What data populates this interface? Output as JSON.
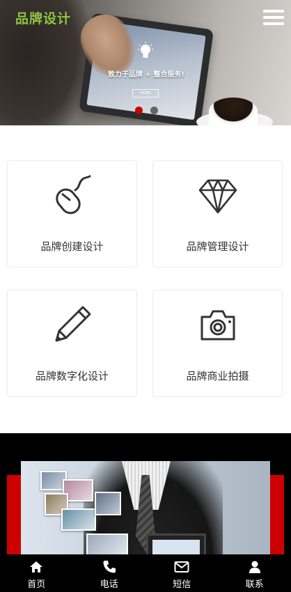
{
  "header": {
    "logo_text": "品牌设计",
    "logo_color": "#8fc642",
    "menu_icon": "hamburger-menu-icon"
  },
  "hero": {
    "slogan": "致力于品牌 + 整合服务!",
    "button_text": "MORE",
    "bulb_icon": "lightbulb-icon",
    "slide_count": 2,
    "active_slide": 1,
    "active_dot_color": "#c90000"
  },
  "services": [
    {
      "label": "品牌创建设计",
      "icon": "mouse-icon"
    },
    {
      "label": "品牌管理设计",
      "icon": "diamond-icon"
    },
    {
      "label": "品牌数字化设计",
      "icon": "pencil-icon"
    },
    {
      "label": "品牌商业拍摄",
      "icon": "camera-icon"
    }
  ],
  "accent_color": "#cc0000",
  "bottom_nav": [
    {
      "label": "首页",
      "icon": "home-icon"
    },
    {
      "label": "电话",
      "icon": "phone-icon"
    },
    {
      "label": "短信",
      "icon": "envelope-icon"
    },
    {
      "label": "联系",
      "icon": "user-icon"
    }
  ]
}
